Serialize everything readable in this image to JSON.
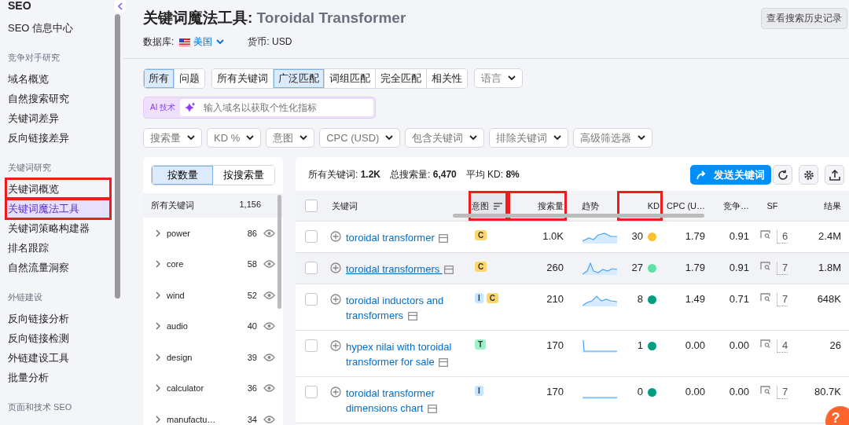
{
  "sidebar": {
    "title": "SEO",
    "sections": [
      {
        "items": [
          {
            "label": "SEO 信息中心",
            "selected": false,
            "highlighted": false
          }
        ]
      },
      {
        "heading": "竞争对手研究",
        "items": [
          {
            "label": "域名概览",
            "selected": false,
            "highlighted": false
          },
          {
            "label": "自然搜索研究",
            "selected": false,
            "highlighted": false
          },
          {
            "label": "关键词差异",
            "selected": false,
            "highlighted": false
          },
          {
            "label": "反向链接差异",
            "selected": false,
            "highlighted": false
          }
        ]
      },
      {
        "heading": "关键词研究",
        "items": [
          {
            "label": "关键词概览",
            "selected": false,
            "highlighted": true
          },
          {
            "label": "关键词魔法工具",
            "selected": true,
            "highlighted": true
          },
          {
            "label": "关键词策略构建器",
            "selected": false,
            "highlighted": false
          },
          {
            "label": "排名跟踪",
            "selected": false,
            "highlighted": false
          },
          {
            "label": "自然流量洞察",
            "selected": false,
            "highlighted": false
          }
        ]
      },
      {
        "heading": "外链建设",
        "items": [
          {
            "label": "反向链接分析",
            "selected": false,
            "highlighted": false
          },
          {
            "label": "反向链接检测",
            "selected": false,
            "highlighted": false
          },
          {
            "label": "外链建设工具",
            "selected": false,
            "highlighted": false
          },
          {
            "label": "批量分析",
            "selected": false,
            "highlighted": false
          }
        ]
      },
      {
        "heading": "页面和技术 SEO"
      }
    ]
  },
  "header": {
    "title": "关键词魔法工具:",
    "query": "Toroidal Transformer",
    "history_button": "查看搜索历史记录",
    "database_label": "数据库:",
    "database": "美国",
    "currency": "货币: USD"
  },
  "match_tabs": [
    {
      "label": "所有",
      "selected": true
    },
    {
      "label": "问题",
      "selected": false
    }
  ],
  "type_tabs": [
    {
      "label": "所有关键词",
      "selected": false
    },
    {
      "label": "广泛匹配",
      "selected": true
    },
    {
      "label": "词组匹配",
      "selected": false
    },
    {
      "label": "完全匹配",
      "selected": false
    },
    {
      "label": "相关性",
      "selected": false
    }
  ],
  "language_dropdown": "语言",
  "ai": {
    "badge": "AI 技术",
    "placeholder": "输入域名以获取个性化指标"
  },
  "filters": [
    "搜索量",
    "KD %",
    "意图",
    "CPC (USD)",
    "包含关键词",
    "排除关键词",
    "高级筛选器"
  ],
  "groups": {
    "tabs": [
      {
        "label": "按数量",
        "selected": true
      },
      {
        "label": "按搜索量",
        "selected": false
      }
    ],
    "total_label": "所有关键词",
    "total": "1,156",
    "items": [
      {
        "label": "power",
        "count": "86"
      },
      {
        "label": "core",
        "count": "58"
      },
      {
        "label": "wind",
        "count": "52"
      },
      {
        "label": "audio",
        "count": "40"
      },
      {
        "label": "design",
        "count": "39"
      },
      {
        "label": "calculator",
        "count": "36"
      },
      {
        "label": "manufactu…",
        "count": "34"
      }
    ]
  },
  "summary": {
    "all_keywords": "所有关键词: **1.2K**",
    "total_volume": "总搜索量: **6,470**",
    "avg_kd": "平均 KD: **8%**",
    "send_button": "发送关键词"
  },
  "table": {
    "all_checked": false,
    "columns": [
      {
        "label": "关键词",
        "highlighted": false
      },
      {
        "label": "意图",
        "highlighted": true
      },
      {
        "label": "搜索量",
        "highlighted": true
      },
      {
        "label": "趋势",
        "highlighted": false
      },
      {
        "label": "KD",
        "highlighted": true
      },
      {
        "label": "CPC (U…",
        "highlighted": false
      },
      {
        "label": "竞争…",
        "highlighted": false
      },
      {
        "label": "SF",
        "highlighted": false
      },
      {
        "label": "结果",
        "highlighted": false
      }
    ],
    "rows": [
      {
        "keyword": "toroidal transformer",
        "selected": false,
        "checked": false,
        "intents": [
          {
            "label": "C",
            "color": "#fcd66c"
          }
        ],
        "volume": "1.0K",
        "kd": {
          "value": "30",
          "color": "#fcc02e"
        },
        "cpc": "1.79",
        "competition": "0.91",
        "sf": "6",
        "results": "2.4M"
      },
      {
        "keyword": "toroidal transformers",
        "selected": true,
        "checked": false,
        "intents": [
          {
            "label": "C",
            "color": "#fcd66c"
          }
        ],
        "volume": "260",
        "kd": {
          "value": "27",
          "color": "#5fe0a4"
        },
        "cpc": "1.79",
        "competition": "0.91",
        "sf": "7",
        "results": "1.8M"
      },
      {
        "keyword": "toroidal inductors and transformers",
        "selected": false,
        "intents": [
          {
            "label": "I",
            "color": "#c4e4ff"
          },
          {
            "label": "C",
            "color": "#fcd66c"
          }
        ],
        "checked": false,
        "volume": "210",
        "kd": {
          "value": "8",
          "color": "#009f81"
        },
        "cpc": "1.49",
        "competition": "0.71",
        "sf": "7",
        "results": "648K"
      },
      {
        "keyword": "hypex nilai with toroidal transformer for sale",
        "selected": false,
        "intents": [
          {
            "label": "T",
            "color": "#9ef2c9"
          }
        ],
        "checked": false,
        "volume": "170",
        "kd": {
          "value": "1",
          "color": "#009f81"
        },
        "cpc": "0.00",
        "competition": "0.00",
        "sf": "4",
        "results": "26"
      },
      {
        "keyword": "toroidal transformer dimensions chart",
        "selected": false,
        "intents": [
          {
            "label": "I",
            "color": "#c4e4ff"
          }
        ],
        "checked": false,
        "volume": "170",
        "kd": {
          "value": "0",
          "color": "#009f81"
        },
        "cpc": "0.00",
        "competition": "0.00",
        "sf": "7",
        "results": "80.7K"
      }
    ]
  },
  "help_button": "?"
}
